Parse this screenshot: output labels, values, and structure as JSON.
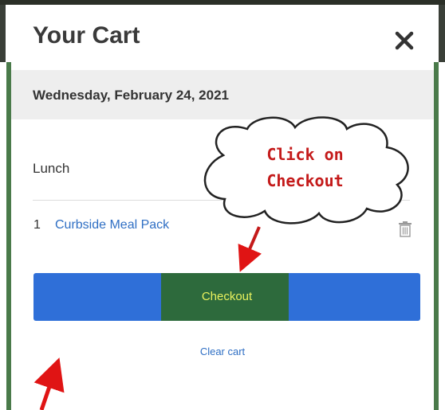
{
  "modal": {
    "title": "Your Cart",
    "close_icon": "close-icon",
    "date": "Wednesday, February 24, 2021",
    "section": "Lunch",
    "items": [
      {
        "qty": "1",
        "name": "Curbside Meal Pack",
        "remove_icon": "trash-icon"
      }
    ],
    "checkout_label": "Checkout",
    "clear_label": "Clear cart"
  },
  "annotation": {
    "callout_line1": "Click on",
    "callout_line2": "Checkout",
    "callout_color": "#c41a1a"
  },
  "colors": {
    "checkout_button": "#2f6fd8",
    "checkout_highlight": "#2d6a3c",
    "checkout_text": "#eaf25e",
    "link": "#2f6fc4",
    "arrow": "#e01414"
  }
}
